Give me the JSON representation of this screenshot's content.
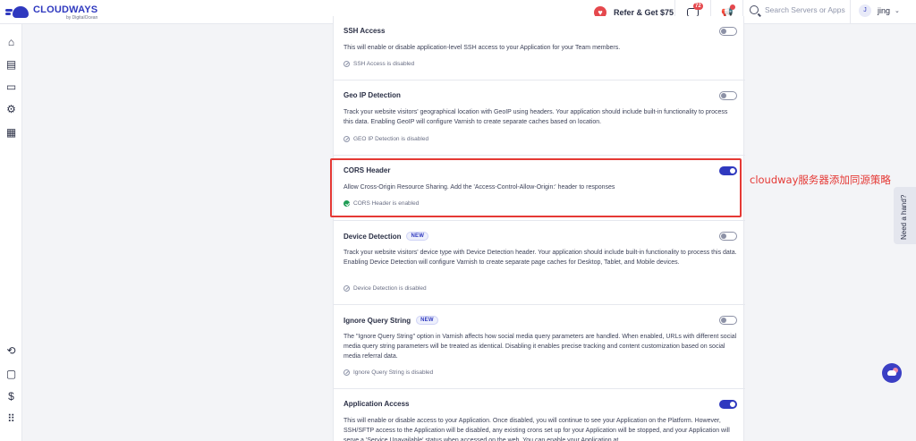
{
  "brand": {
    "name": "CLOUDWAYS",
    "byline": "by DigitalOcean"
  },
  "topbar": {
    "refer_label": "Refer & Get $75",
    "notifications_count": "72",
    "search_placeholder": "Search Servers or Apps",
    "user_initial": "J",
    "user_name": "jing"
  },
  "sidebar": {
    "icons": [
      "home-icon",
      "servers-icon",
      "applications-icon",
      "settings-icon",
      "billing-icon",
      "team-icon",
      "folder-icon",
      "billing-dollar-icon",
      "apps-grid-icon"
    ]
  },
  "sections": [
    {
      "title": "SSH Access",
      "description": "This will enable or disable application-level SSH access to your Application for your Team members.",
      "status": "SSH Access is disabled",
      "enabled": false
    },
    {
      "title": "Geo IP Detection",
      "description": "Track your website visitors' geographical location with GeoIP using headers. Your application should include built-in functionality to process this data. Enabling GeoIP will configure Varnish to create separate caches based on location.",
      "status": "GEO IP Detection is disabled",
      "enabled": false
    },
    {
      "title": "CORS Header",
      "description": "Allow Cross-Origin Resource Sharing. Add the 'Access-Control-Allow-Origin:' header to responses",
      "status": "CORS Header is enabled",
      "enabled": true
    },
    {
      "title": "Device Detection",
      "badge": "NEW",
      "description": "Track your website visitors' device type with Device Detection header. Your application should include built-in functionality to process this data. Enabling Device Detection will configure Varnish to create separate page caches for Desktop, Tablet, and Mobile devices.",
      "status": "Device Detection is disabled",
      "enabled": false
    },
    {
      "title": "Ignore Query String",
      "badge": "NEW",
      "description": "The \"Ignore Query String\" option in Varnish affects how social media query parameters are handled. When enabled, URLs with different social media query string parameters will be treated as identical. Disabling it enables precise tracking and content customization based on social media referral data.",
      "status": "Ignore Query String is disabled",
      "enabled": false
    },
    {
      "title": "Application Access",
      "description": "This will enable or disable access to your Application. Once disabled, you will continue to see your Application on the Platform. However, SSH/SFTP access to the Application will be disabled, any existing crons set up for your Application will be stopped, and your Application will serve a 'Service Unavailable' status when accessed on the web. You can enable your Application at",
      "enabled": true
    }
  ],
  "annotation": "cloudway服务器添加同源策略",
  "help_tab": "Need a hand?",
  "colors": {
    "brand": "#2f39bf",
    "annotation": "#e53935",
    "enabled_status": "#1f9d55"
  }
}
